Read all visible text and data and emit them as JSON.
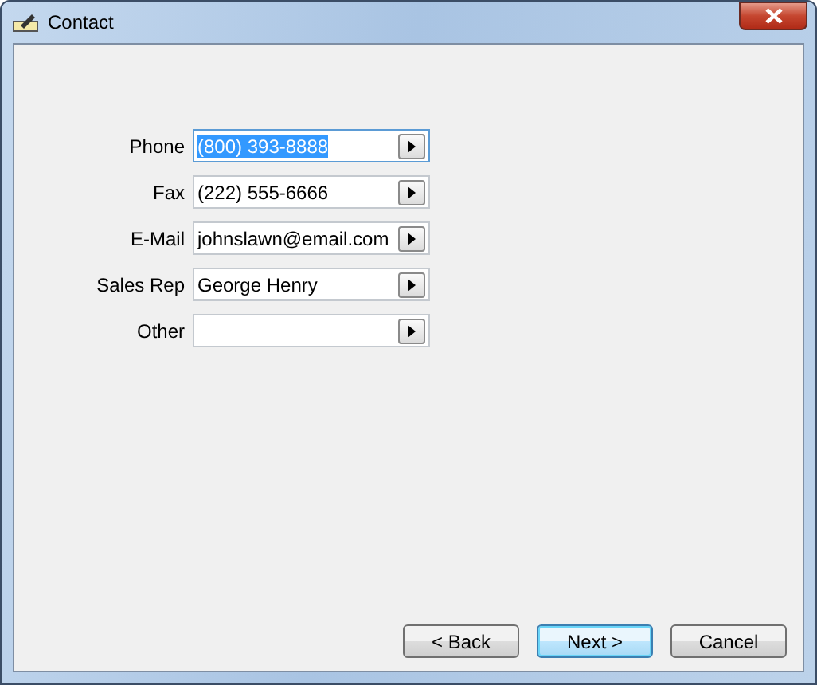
{
  "window": {
    "title": "Contact"
  },
  "fields": [
    {
      "label": "Phone",
      "value": "(800) 393-8888",
      "selected": true
    },
    {
      "label": "Fax",
      "value": "(222) 555-6666",
      "selected": false
    },
    {
      "label": "E-Mail",
      "value": "johnslawn@email.com",
      "selected": false
    },
    {
      "label": "Sales Rep",
      "value": "George Henry",
      "selected": false
    },
    {
      "label": "Other",
      "selected": false
    }
  ],
  "buttons": [
    {
      "label": "< Back",
      "default": false
    },
    {
      "label": "Next >",
      "default": true
    },
    {
      "label": "Cancel",
      "default": false
    }
  ]
}
